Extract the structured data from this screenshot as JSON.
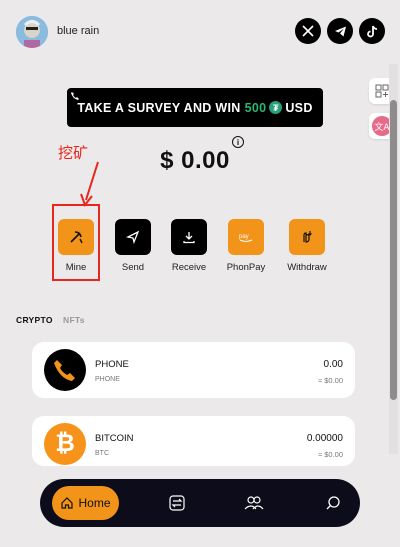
{
  "header": {
    "username": "blue rain",
    "avatar_icon": "avatar-icon",
    "socials": [
      "x-icon",
      "telegram-icon",
      "tiktok-icon"
    ]
  },
  "floating": [
    "apps-icon",
    "translate-icon"
  ],
  "banner": {
    "text_prefix": "TAKE A SURVEY AND WIN",
    "amount": "500",
    "currency": "USD",
    "icon": "phone-icon"
  },
  "annotation": {
    "label": "挖矿"
  },
  "balance": {
    "amount": "$ 0.00"
  },
  "actions": [
    {
      "label": "Mine",
      "icon": "pickaxe-icon",
      "color": "#f2931a"
    },
    {
      "label": "Send",
      "icon": "send-icon",
      "color": "#000000"
    },
    {
      "label": "Receive",
      "icon": "download-icon",
      "color": "#000000"
    },
    {
      "label": "PhonPay",
      "icon": "phonpay-icon",
      "color": "#f2931a"
    },
    {
      "label": "Withdraw",
      "icon": "withdraw-icon",
      "color": "#f2931a"
    }
  ],
  "tabs": [
    {
      "label": "CRYPTO",
      "active": true
    },
    {
      "label": "NFTs",
      "active": false
    }
  ],
  "assets": [
    {
      "name": "PHONE",
      "symbol": "PHONE",
      "balance": "0.00",
      "usd": "≈ $0.00",
      "color": "#000000",
      "accent": "#f2931a"
    },
    {
      "name": "BITCOIN",
      "symbol": "BTC",
      "balance": "0.00000",
      "usd": "≈ $0.00",
      "color": "#f7931a"
    }
  ],
  "nav": {
    "home_label": "Home",
    "items": [
      "home-icon",
      "swap-icon",
      "people-icon",
      "search-icon"
    ],
    "accent": "#f2931a"
  }
}
